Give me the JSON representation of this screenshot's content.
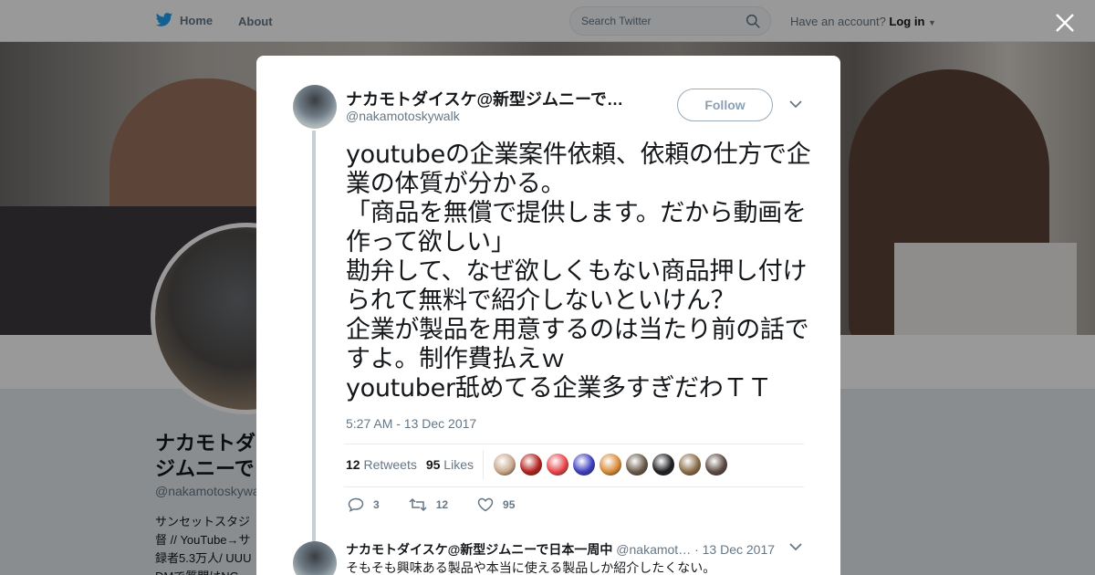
{
  "nav": {
    "home_label": "Home",
    "about_label": "About",
    "search_placeholder": "Search Twitter",
    "account_text": "Have an account?",
    "login_label": "Log in"
  },
  "profile": {
    "name": "ナカモトダ\nジムニーで",
    "handle": "@nakamotoskywa",
    "bio": "サンセットスタジ\n督 // YouTube→サ\n録者5.3万人/ UUU\nDMで質問はNG"
  },
  "tweet": {
    "author_name": "ナカモトダイスケ@新型ジムニーで日本一周中",
    "author_handle": "@nakamotoskywalk",
    "follow_label": "Follow",
    "text": "youtubeの企業案件依頼、依頼の仕方で企業の体質が分かる。\n「商品を無償で提供します。だから動画を作って欲しい」\n勘弁して、なぜ欲しくもない商品押し付けられて無料で紹介しないといけん？\n企業が製品を用意するのは当たり前の話ですよ。制作費払えｗ\nyoutuber舐めてる企業多すぎだわＴＴ",
    "timestamp": "5:27 AM - 13 Dec 2017",
    "retweets_count": "12",
    "retweets_label": "Retweets",
    "likes_count": "95",
    "likes_label": "Likes",
    "reply_count": "3",
    "retweet_action_count": "12",
    "like_action_count": "95",
    "likers": [
      {
        "color": "#c9a88b"
      },
      {
        "color": "#b3231e"
      },
      {
        "color": "#e8454a"
      },
      {
        "color": "#3d3fbf"
      },
      {
        "color": "#d98b3a"
      },
      {
        "color": "#6b5a4a"
      },
      {
        "color": "#1f1f22"
      },
      {
        "color": "#8a6d48"
      },
      {
        "color": "#5c4a42"
      }
    ]
  },
  "reply": {
    "name": "ナカモトダイスケ@新型ジムニーで日本一周中",
    "handle": "@nakamot…",
    "date": "· 13 Dec 2017",
    "text": "そもそも興味ある製品や本当に使える製品しか紹介したくない。"
  },
  "colors": {
    "twitter_blue": "#1da1f2",
    "meta_gray": "#657786"
  }
}
